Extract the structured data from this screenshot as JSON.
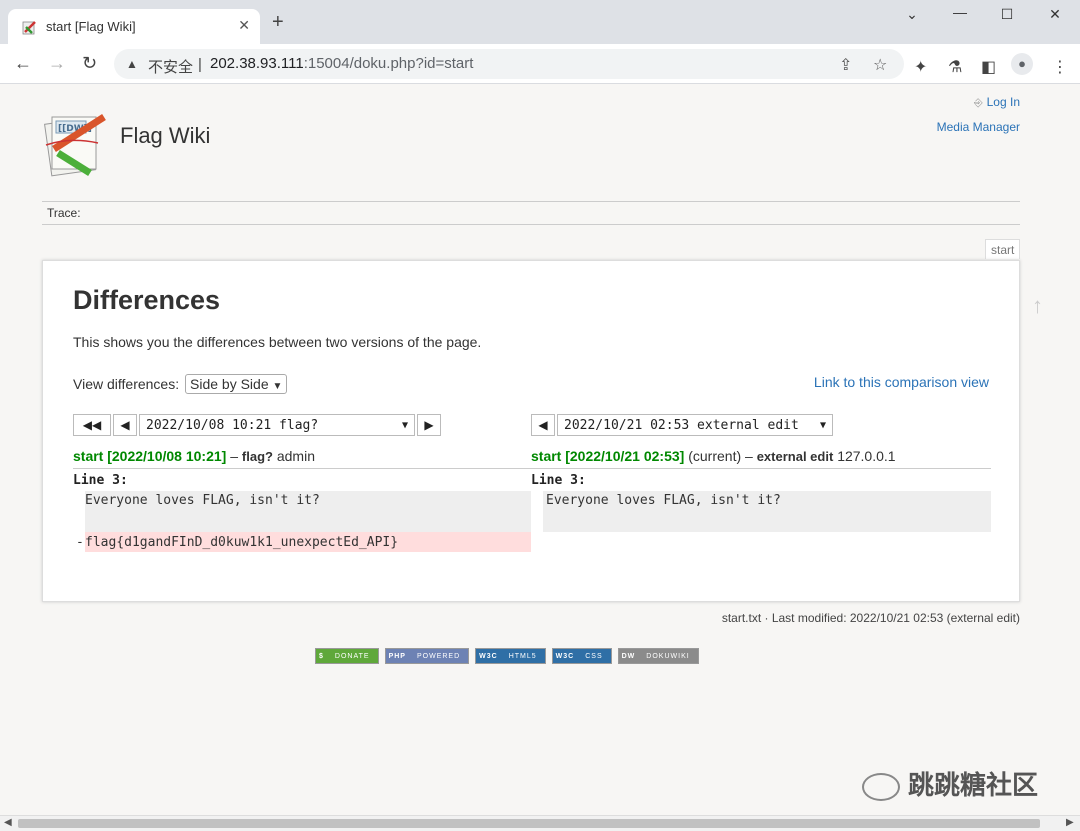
{
  "browser": {
    "tab_title": "start [Flag Wiki]",
    "new_tab": "+",
    "insecure_label": "不安全",
    "separator": "|",
    "url_host": "202.38.93.111",
    "url_rest": ":15004/doku.php?id=start"
  },
  "site": {
    "title": "Flag Wiki",
    "login": "Log In",
    "media_manager": "Media Manager",
    "trace": "Trace:",
    "page_id": "start"
  },
  "content": {
    "heading": "Differences",
    "intro": "This shows you the differences between two versions of the page.",
    "view_label": "View differences:",
    "view_select": "Side by Side",
    "comparison_link": "Link to this comparison view",
    "left": {
      "rev_select": "2022/10/08 10:21 flag?",
      "rev_link": "start [2022/10/08 10:21]",
      "dash": "–",
      "summary": "flag?",
      "user": "admin",
      "line_label": "Line 3:",
      "context": "Everyone loves FLAG, isn't it?",
      "del_marker": "-",
      "deleted": "flag{d1gandFInD_d0kuw1k1_unexpectEd_API}"
    },
    "right": {
      "rev_select": "2022/10/21 02:53 external edit",
      "rev_link": "start [2022/10/21 02:53]",
      "current": "(current)",
      "dash": "–",
      "summary": "external edit",
      "ip": "127.0.0.1",
      "line_label": "Line 3:",
      "context": "Everyone loves FLAG, isn't it?"
    }
  },
  "footer": {
    "doc_info": "start.txt · Last modified: 2022/10/21 02:53 (external edit)",
    "badges": [
      {
        "left": "$",
        "right": "DONATE",
        "color": "#5fa83a"
      },
      {
        "left": "PHP",
        "right": "POWERED",
        "color": "#6d82b4"
      },
      {
        "left": "W3C",
        "right": "HTML5",
        "color": "#2f6fa6"
      },
      {
        "left": "W3C",
        "right": "CSS",
        "color": "#2f6fa6"
      },
      {
        "left": "DW",
        "right": "DOKUWIKI",
        "color": "#8b8b8b"
      }
    ]
  },
  "watermark": "跳跳糖社区"
}
